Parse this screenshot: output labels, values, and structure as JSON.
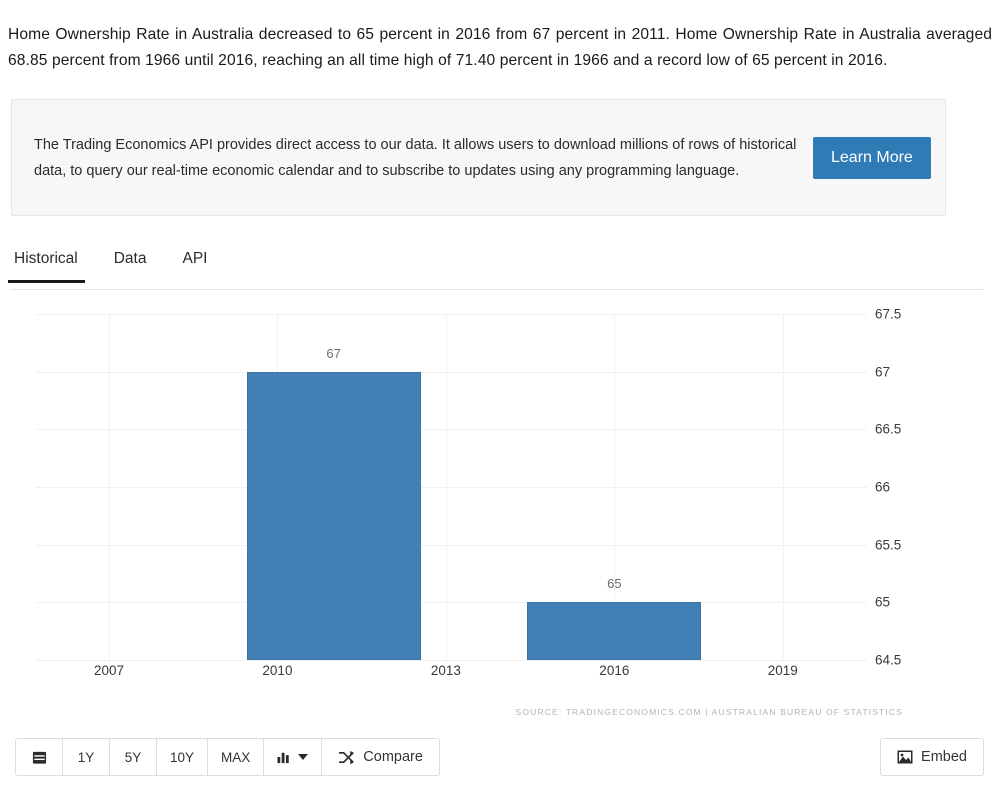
{
  "intro": {
    "paragraph": "Home Ownership Rate in Australia decreased to 65 percent in 2016 from 67 percent in 2011. Home Ownership Rate in Australia averaged 68.85 percent from 1966 until 2016, reaching an all time high of 71.40 percent in 1966 and a record low of 65 percent in 2016."
  },
  "promo": {
    "text": "The Trading Economics API provides direct access to our data. It allows users to download millions of rows of historical data, to query our real-time economic calendar and to subscribe to updates using any programming language.",
    "button_label": "Learn More",
    "button_color": "#2f7bb5"
  },
  "tabs": [
    {
      "label": "Historical",
      "active": true
    },
    {
      "label": "Data",
      "active": false
    },
    {
      "label": "API",
      "active": false
    }
  ],
  "chart_data": {
    "type": "bar",
    "title": "",
    "subtitle": "",
    "xlabel": "",
    "ylabel": "",
    "categories": [
      "2011",
      "2016"
    ],
    "values": [
      67,
      65
    ],
    "data_labels": [
      "67",
      "65"
    ],
    "bar_color": "#4180b4",
    "ylim": [
      64.5,
      67.5
    ],
    "yticks": [
      "67.5",
      "67",
      "66.5",
      "66",
      "65.5",
      "65",
      "64.5"
    ],
    "ytick_values": [
      67.5,
      67,
      66.5,
      66,
      65.5,
      65,
      64.5
    ],
    "xticks": [
      "2007",
      "2010",
      "2013",
      "2016",
      "2019"
    ],
    "xtick_values": [
      2007,
      2010,
      2013,
      2016,
      2019
    ],
    "xlim": [
      2005.7,
      2020.5
    ],
    "grid": true,
    "legend": false,
    "source": "SOURCE: TRADINGECONOMICS.COM | AUSTRALIAN BUREAU OF STATISTICS"
  },
  "toolbar": {
    "calendar_label": "",
    "ranges": [
      "1Y",
      "5Y",
      "10Y",
      "MAX"
    ],
    "chart_type_label": "",
    "compare_label": "Compare",
    "embed_label": "Embed"
  }
}
